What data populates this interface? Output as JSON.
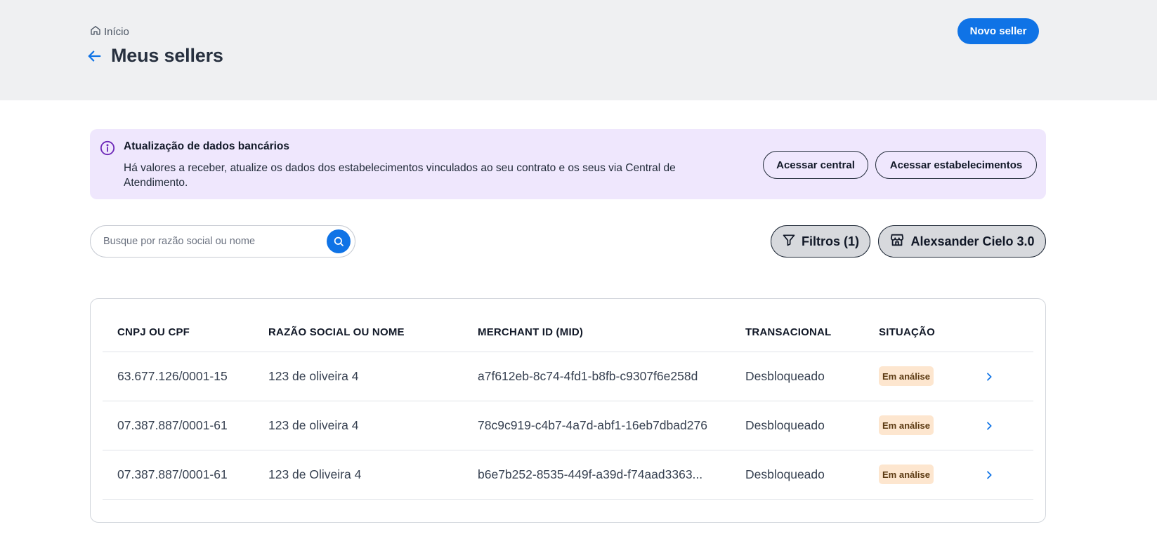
{
  "header": {
    "breadcrumb": "Início",
    "title": "Meus sellers",
    "new_button": "Novo seller"
  },
  "alert": {
    "title": "Atualização de dados bancários",
    "text": "Há valores a receber, atualize os dados dos estabelecimentos vinculados ao seu contrato e os seus via Central de Atendimento.",
    "btn_central": "Acessar central",
    "btn_estab": "Acessar estabelecimentos"
  },
  "search": {
    "placeholder": "Busque por razão social ou nome"
  },
  "filters": {
    "filter_label": "Filtros (1)",
    "store_label": "Alexsander Cielo 3.0"
  },
  "table": {
    "headers": [
      "CNPJ OU CPF",
      "RAZÃO SOCIAL OU NOME",
      "MERCHANT ID (MID)",
      "TRANSACIONAL",
      "SITUAÇÃO"
    ],
    "rows": [
      {
        "doc": "63.677.126/0001-15",
        "name": "123 de oliveira 4",
        "mid": "a7f612eb-8c74-4fd1-b8fb-c9307f6e258d",
        "trans": "Desbloqueado",
        "status": "Em análise"
      },
      {
        "doc": "07.387.887/0001-61",
        "name": "123 de oliveira 4",
        "mid": "78c9c919-c4b7-4a7d-abf1-16eb7dbad276",
        "trans": "Desbloqueado",
        "status": "Em análise"
      },
      {
        "doc": "07.387.887/0001-61",
        "name": "123 de Oliveira 4",
        "mid": "b6e7b252-8535-449f-a39d-f74aad3363...",
        "trans": "Desbloqueado",
        "status": "Em análise"
      }
    ]
  },
  "colors": {
    "primary": "#0f73e6",
    "alert_bg": "#efe7fd",
    "badge_bg": "#fde6cf"
  }
}
